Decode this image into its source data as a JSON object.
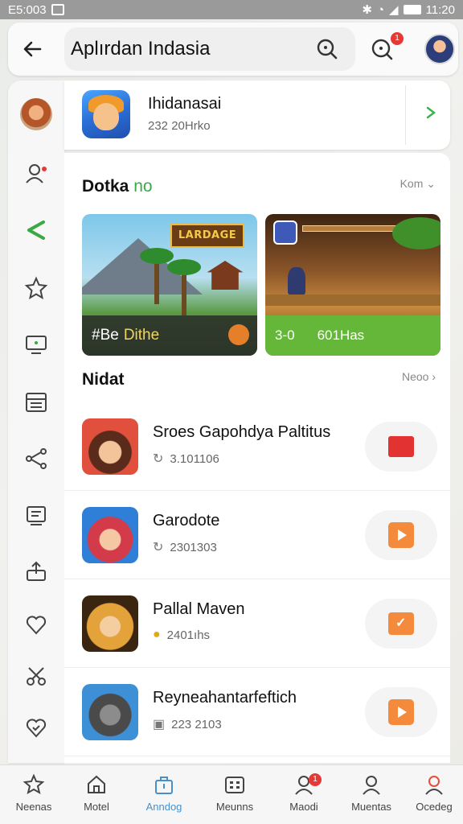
{
  "status_bar": {
    "time": "11:20",
    "left_text": "E5:003"
  },
  "app_bar": {
    "title": "Aplırdan Indasia",
    "notification_count": "1"
  },
  "featured": {
    "title": "Ihidanasai",
    "subtitle": "232 20Hrko"
  },
  "section_1": {
    "title": "Dotka",
    "title_accent": "no",
    "more": "Kom"
  },
  "banners": [
    {
      "sign": "LARDAGE",
      "label_a": "#Be",
      "label_b": "Dithe"
    },
    {
      "label_a": "3-0",
      "label_b": "601Has"
    }
  ],
  "section_2": {
    "title": "Nidat",
    "more": "Neoo"
  },
  "list": [
    {
      "title": "Sroes Gapohdya Paltitus",
      "meta": "3.101106",
      "meta_icon": "refresh-icon",
      "action": "stop"
    },
    {
      "title": "Garodote",
      "meta": "2301303",
      "meta_icon": "refresh-icon",
      "action": "play"
    },
    {
      "title": "Pallal Maven",
      "meta": "2401ıhs",
      "meta_icon": "emoji-icon",
      "action": "chat"
    },
    {
      "title": "Reyneahantarfeftich",
      "meta": "223 2103",
      "meta_icon": "disk-icon",
      "action": "play"
    }
  ],
  "bottom_nav": [
    {
      "label": "Neenas"
    },
    {
      "label": "Motel"
    },
    {
      "label": "Anndog",
      "active": true
    },
    {
      "label": "Meunns"
    },
    {
      "label": "Maodi",
      "badge": "1"
    },
    {
      "label": "Muentas"
    },
    {
      "label": "Ocedeg"
    }
  ],
  "colors": {
    "accent_green": "#3aa845",
    "accent_orange": "#f38a3c",
    "stop_red": "#e23232",
    "active_blue": "#4a90c8"
  }
}
